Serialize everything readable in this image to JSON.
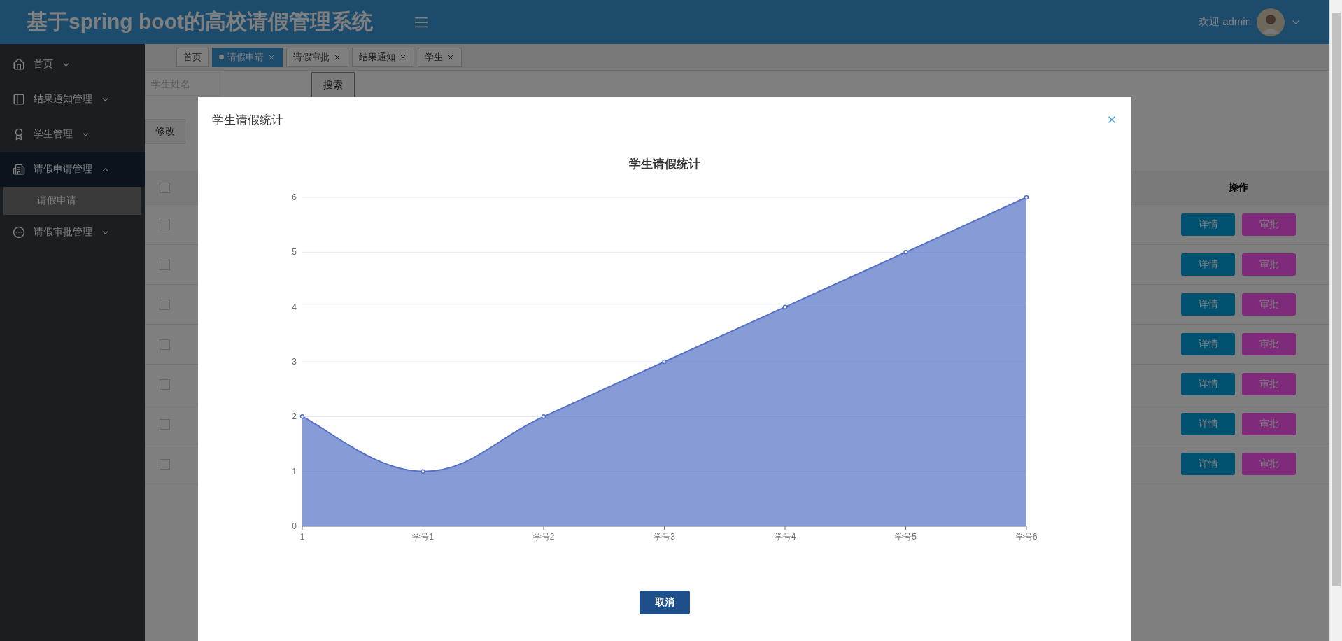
{
  "header": {
    "title": "基于spring boot的高校请假管理系统",
    "welcome": "欢迎 admin"
  },
  "sidebar": {
    "items": [
      {
        "label": "首页",
        "expanded": false
      },
      {
        "label": "结果通知管理",
        "expanded": false
      },
      {
        "label": "学生管理",
        "expanded": false
      },
      {
        "label": "请假申请管理",
        "expanded": true,
        "children": [
          {
            "label": "请假申请",
            "selected": true
          }
        ]
      },
      {
        "label": "请假审批管理",
        "expanded": false
      }
    ]
  },
  "tabs": [
    {
      "label": "首页",
      "selected": false,
      "closable": false
    },
    {
      "label": "请假申请",
      "selected": true,
      "closable": true
    },
    {
      "label": "请假审批",
      "selected": false,
      "closable": true
    },
    {
      "label": "结果通知",
      "selected": false,
      "closable": true
    },
    {
      "label": "学生",
      "selected": false,
      "closable": true
    }
  ],
  "search": {
    "placeholder": "学生姓名",
    "button": "搜索"
  },
  "toolbar": [
    "修改"
  ],
  "table": {
    "header_checked": false,
    "columns": [
      "操作"
    ],
    "rows": [
      {
        "checked": false,
        "actions": [
          "详情",
          "审批"
        ]
      },
      {
        "checked": false,
        "actions": [
          "详情",
          "审批"
        ]
      },
      {
        "checked": false,
        "actions": [
          "详情",
          "审批"
        ]
      },
      {
        "checked": false,
        "actions": [
          "详情",
          "审批"
        ]
      },
      {
        "checked": false,
        "actions": [
          "详情",
          "审批"
        ]
      },
      {
        "checked": false,
        "actions": [
          "详情",
          "审批"
        ]
      },
      {
        "checked": false,
        "actions": [
          "详情",
          "审批"
        ]
      }
    ]
  },
  "modal": {
    "title": "学生请假统计",
    "buttons": [
      "取消"
    ],
    "chart_data": {
      "type": "area",
      "title": "学生请假统计",
      "categories": [
        "1",
        "学号1",
        "学号2",
        "学号3",
        "学号4",
        "学号5",
        "学号6"
      ],
      "series": [
        {
          "color": "#5470c6",
          "values": [
            2,
            1,
            2,
            3,
            4,
            5,
            6
          ]
        }
      ],
      "grid": true,
      "ylim": [
        0,
        6
      ],
      "yticks": [
        0,
        1,
        2,
        3,
        4,
        5,
        6
      ]
    }
  }
}
